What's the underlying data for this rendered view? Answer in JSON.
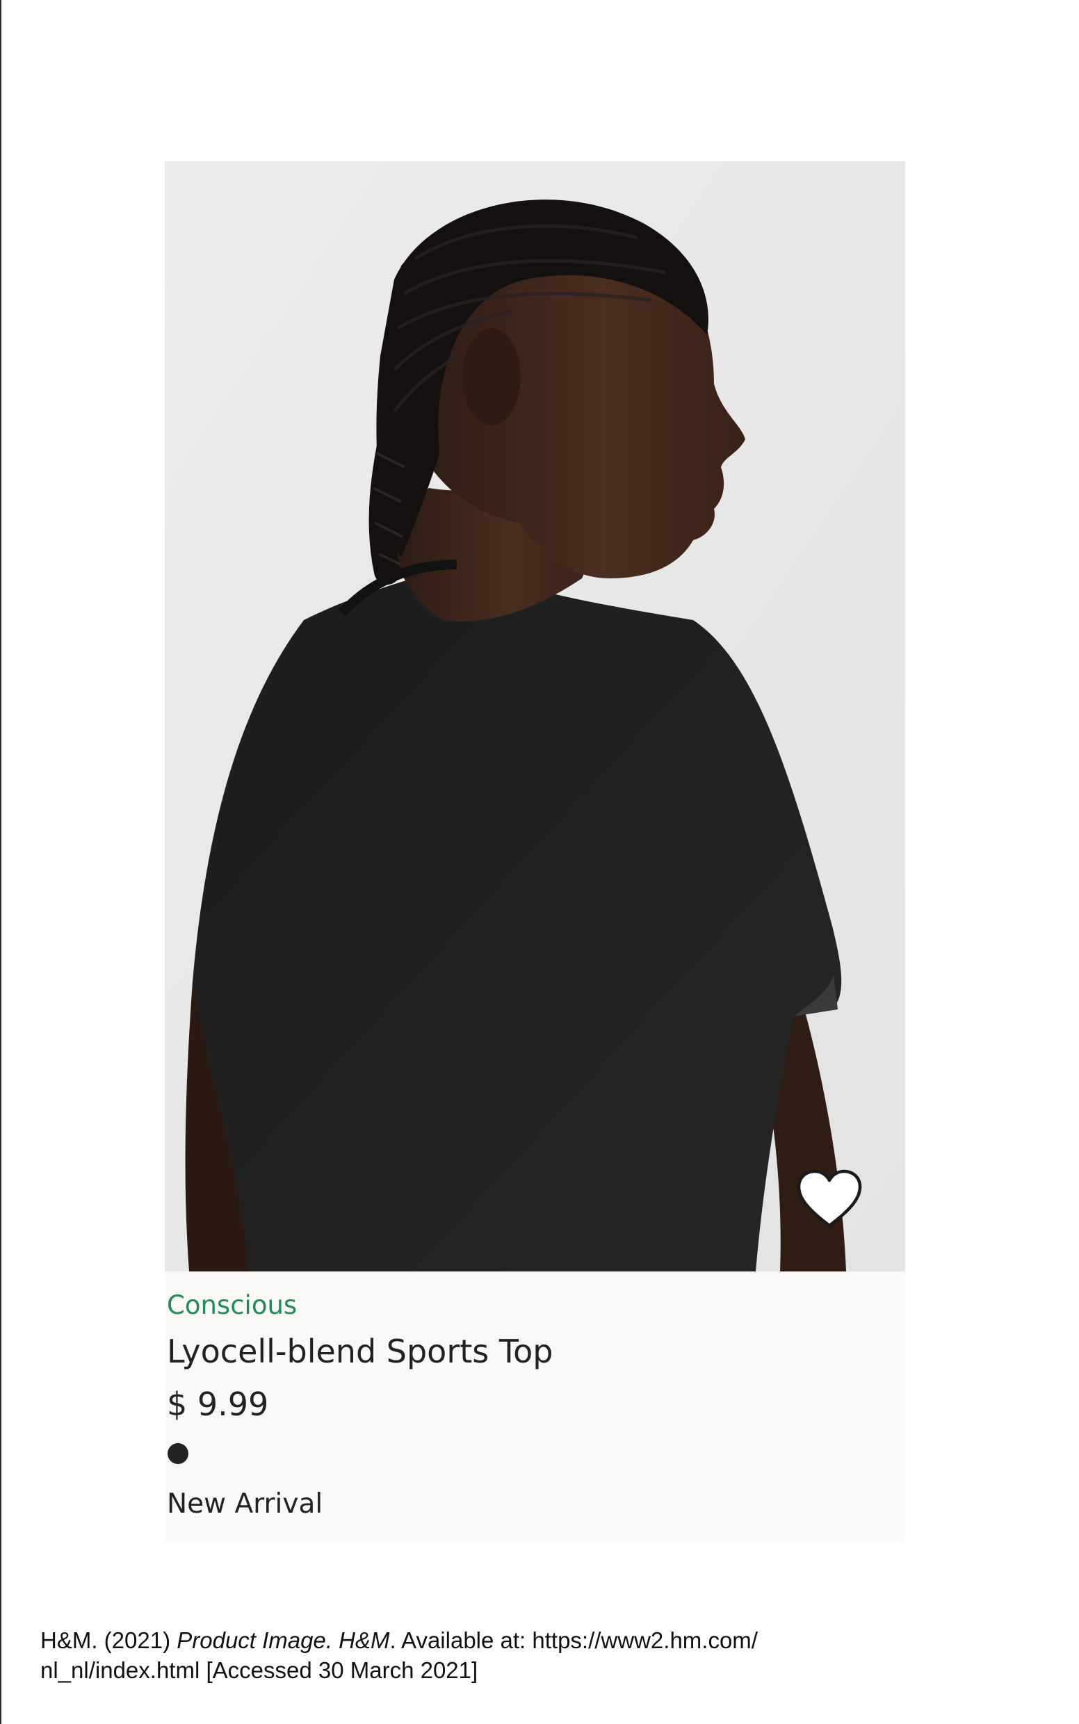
{
  "product": {
    "sustainability_label": "Conscious",
    "title": "Lyocell-blend Sports Top",
    "price": "$ 9.99",
    "badge": "New Arrival",
    "favorite_icon": "heart-outline-icon",
    "swatch_color": "#222222",
    "image_icon": "product-photo"
  },
  "colors": {
    "conscious_green": "#1f8a5b",
    "text_dark": "#222222",
    "card_background": "#faf9f8",
    "photo_background": "#e9e9e9"
  },
  "citation": {
    "source": "H&M. (2021) ",
    "italic_title": "Product Image. H&M",
    "rest_line1": ". Available at: https://www2.hm.com/",
    "line2": "nl_nl/index.html [Accessed 30 March 2021]"
  }
}
